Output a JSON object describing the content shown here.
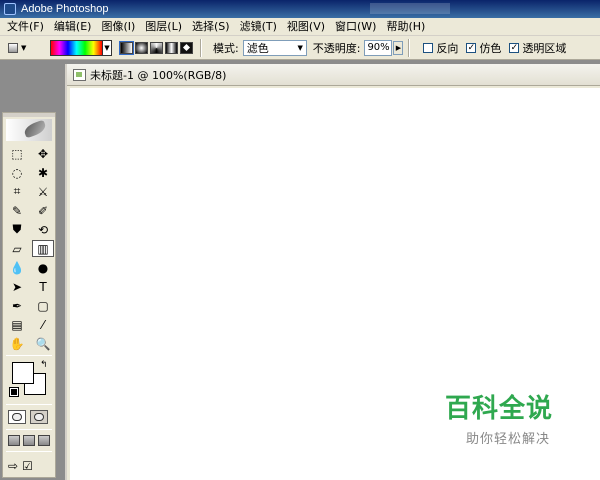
{
  "window": {
    "title": "Adobe Photoshop"
  },
  "menu": [
    "文件(F)",
    "编辑(E)",
    "图像(I)",
    "图层(L)",
    "选择(S)",
    "滤镜(T)",
    "视图(V)",
    "窗口(W)",
    "帮助(H)"
  ],
  "options": {
    "mode_label": "模式:",
    "mode_value": "滤色",
    "opacity_label": "不透明度:",
    "opacity_value": "90%",
    "reverse_label": "反向",
    "reverse_checked": false,
    "dither_label": "仿色",
    "dither_checked": true,
    "transparency_label": "透明区域",
    "transparency_checked": true
  },
  "document": {
    "title": "未标题-1 @ 100%(RGB/8)"
  },
  "watermark": {
    "title": "百科全说",
    "subtitle": "助你轻松解决"
  },
  "tools": [
    {
      "name": "marquee-tool-icon",
      "glyph": "⬚"
    },
    {
      "name": "move-tool-icon",
      "glyph": "✥"
    },
    {
      "name": "lasso-tool-icon",
      "glyph": "◌"
    },
    {
      "name": "magic-wand-tool-icon",
      "glyph": "✱"
    },
    {
      "name": "crop-tool-icon",
      "glyph": "⌗"
    },
    {
      "name": "slice-tool-icon",
      "glyph": "⚔"
    },
    {
      "name": "healing-brush-tool-icon",
      "glyph": "✎"
    },
    {
      "name": "brush-tool-icon",
      "glyph": "✐"
    },
    {
      "name": "clone-stamp-tool-icon",
      "glyph": "⛊"
    },
    {
      "name": "history-brush-tool-icon",
      "glyph": "⟲"
    },
    {
      "name": "eraser-tool-icon",
      "glyph": "▱"
    },
    {
      "name": "gradient-tool-icon",
      "glyph": "▥"
    },
    {
      "name": "blur-tool-icon",
      "glyph": "💧"
    },
    {
      "name": "dodge-tool-icon",
      "glyph": "●"
    },
    {
      "name": "path-selection-tool-icon",
      "glyph": "➤"
    },
    {
      "name": "type-tool-icon",
      "glyph": "T"
    },
    {
      "name": "pen-tool-icon",
      "glyph": "✒"
    },
    {
      "name": "shape-tool-icon",
      "glyph": "▢"
    },
    {
      "name": "notes-tool-icon",
      "glyph": "▤"
    },
    {
      "name": "eyedropper-tool-icon",
      "glyph": "⁄"
    },
    {
      "name": "hand-tool-icon",
      "glyph": "✋"
    },
    {
      "name": "zoom-tool-icon",
      "glyph": "🔍"
    }
  ]
}
